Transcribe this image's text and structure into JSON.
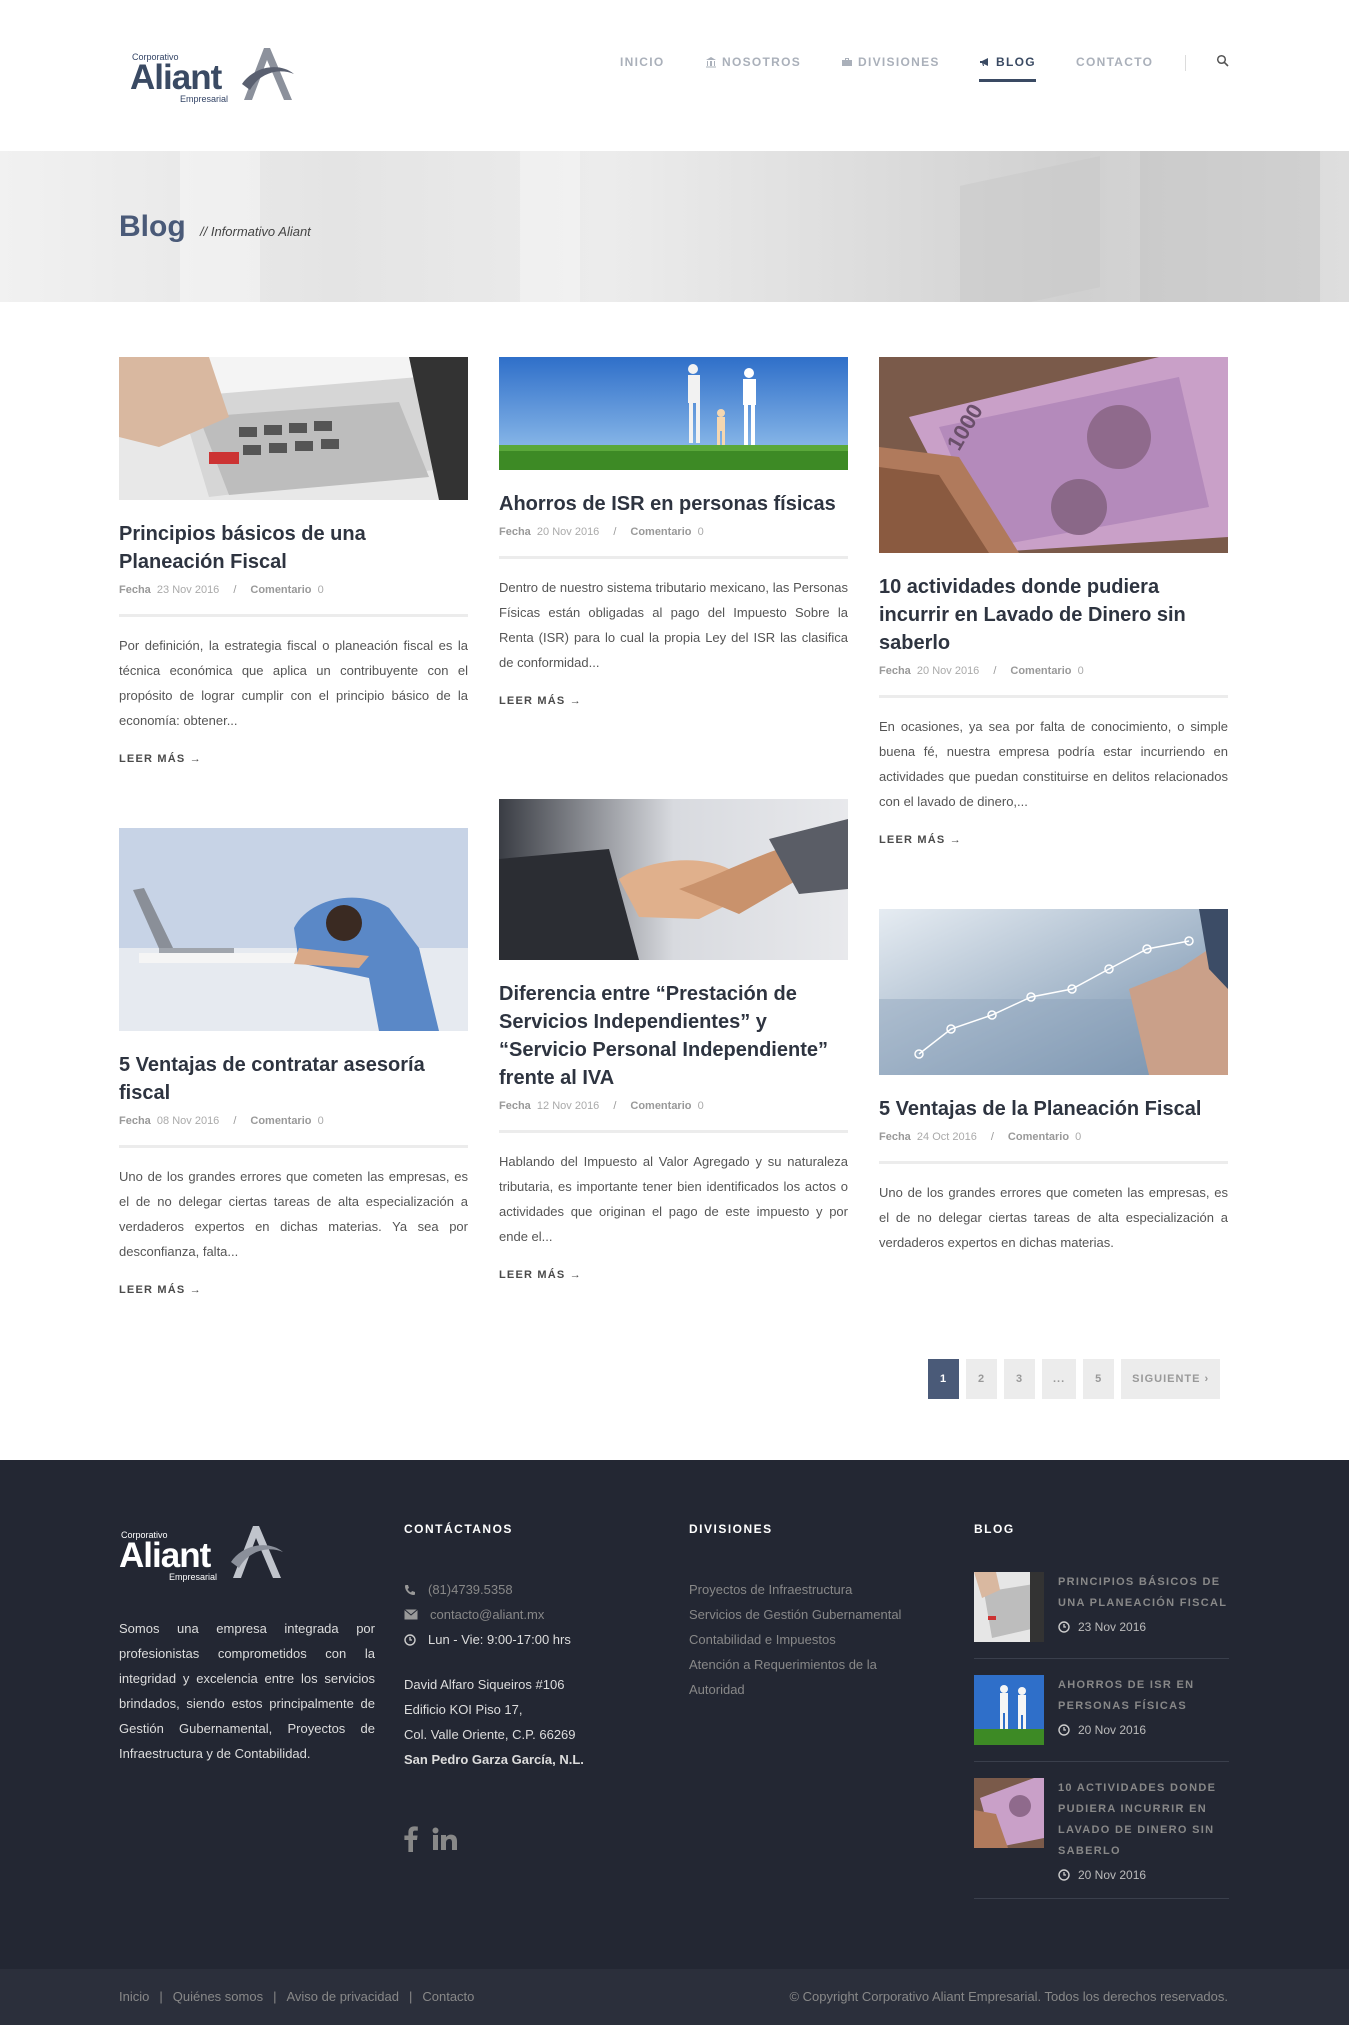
{
  "brand": {
    "corporativo": "Corporativo",
    "name": "Aliant",
    "empresarial": "Empresarial"
  },
  "nav": {
    "items": [
      {
        "label": "INICIO",
        "icon": "none"
      },
      {
        "label": "NOSOTROS",
        "icon": "bank-icon"
      },
      {
        "label": "DIVISIONES",
        "icon": "briefcase-icon"
      },
      {
        "label": "BLOG",
        "icon": "megaphone-icon"
      },
      {
        "label": "CONTACTO",
        "icon": "none"
      }
    ],
    "active": "BLOG"
  },
  "hero": {
    "title": "Blog",
    "subtitle": "// Informativo Aliant"
  },
  "posts": [
    {
      "title": "Principios básicos de una Planeación Fiscal",
      "date_label": "Fecha",
      "date": "23 Nov 2016",
      "comments_label": "Comentario",
      "comments": "0",
      "excerpt": "Por definición, la estrategia fiscal o planeación fiscal es la técnica económica que aplica un contribuyente con el propósito de lograr cumplir con el principio básico de la economía: obtener...",
      "more": "LEER MÁS →"
    },
    {
      "title": "Ahorros de ISR en personas físicas",
      "date_label": "Fecha",
      "date": "20 Nov 2016",
      "comments_label": "Comentario",
      "comments": "0",
      "excerpt": "Dentro de nuestro sistema tributario mexicano, las Personas Físicas están obligadas al pago del Impuesto Sobre la Renta (ISR) para lo cual la propia Ley del ISR las clasifica de conformidad...",
      "more": "LEER MÁS →"
    },
    {
      "title": "10 actividades donde pudiera incurrir en Lavado de Dinero sin saberlo",
      "date_label": "Fecha",
      "date": "20 Nov 2016",
      "comments_label": "Comentario",
      "comments": "0",
      "excerpt": "En ocasiones, ya sea por falta de conocimiento, o simple buena fé, nuestra empresa podría estar incurriendo en actividades que puedan constituirse en delitos relacionados con el lavado de dinero,...",
      "more": "LEER MÁS →"
    },
    {
      "title": "5 Ventajas de contratar asesoría fiscal",
      "date_label": "Fecha",
      "date": "08 Nov 2016",
      "comments_label": "Comentario",
      "comments": "0",
      "excerpt": "Uno de los grandes errores que cometen las empresas, es el de no delegar ciertas tareas de alta especialización a verdaderos expertos en dichas materias. Ya sea por desconfianza, falta...",
      "more": "LEER MÁS →"
    },
    {
      "title": "Diferencia entre “Prestación de Servicios Independientes” y “Servicio Personal Independiente” frente al IVA",
      "date_label": "Fecha",
      "date": "12 Nov 2016",
      "comments_label": "Comentario",
      "comments": "0",
      "excerpt": "Hablando del Impuesto al Valor Agregado y su naturaleza tributaria, es importante tener bien identificados los actos o actividades que originan el pago de este impuesto y por ende el...",
      "more": "LEER MÁS →"
    },
    {
      "title": "5 Ventajas de la Planeación Fiscal",
      "date_label": "Fecha",
      "date": "24 Oct 2016",
      "comments_label": "Comentario",
      "comments": "0",
      "excerpt": "Uno de los grandes errores que cometen las empresas, es el de no delegar ciertas tareas de alta especialización a verdaderos expertos en dichas materias.",
      "more": ""
    }
  ],
  "pagination": {
    "pages": [
      "1",
      "2",
      "3",
      "...",
      "5"
    ],
    "current": "1",
    "next": "SIGUIENTE ›"
  },
  "footer": {
    "about": "Somos una empresa integrada por profesionistas comprometidos con la integridad y excelencia entre los servicios brindados, siendo estos principalmente de Gestión Gubernamental, Proyectos de Infraestructura y de Contabilidad.",
    "contact_title": "CONTÁCTANOS",
    "phone": "(81)4739.5358",
    "email": "contacto@aliant.mx",
    "hours": "Lun - Vie: 9:00-17:00 hrs",
    "address1": "David Alfaro Siqueiros #106",
    "address2": "Edificio KOI Piso 17,",
    "address3": "Col. Valle Oriente, C.P. 66269",
    "address4": "San Pedro Garza García, N.L.",
    "divisions_title": "DIVISIONES",
    "divisions": [
      "Proyectos de Infraestructura",
      "Servicios de Gestión Gubernamental",
      "Contabilidad e Impuestos",
      "Atención a Requerimientos de la Autoridad"
    ],
    "blog_title": "BLOG",
    "blog": [
      {
        "title": "PRINCIPIOS BÁSICOS DE UNA PLANEACIÓN FISCAL",
        "date": "23 Nov 2016"
      },
      {
        "title": "AHORROS DE ISR EN PERSONAS FÍSICAS",
        "date": "20 Nov 2016"
      },
      {
        "title": "10 ACTIVIDADES DONDE PUDIERA INCURRIR EN LAVADO DE DINERO SIN SABERLO",
        "date": "20 Nov 2016"
      }
    ]
  },
  "bottom": {
    "links": [
      "Inicio",
      "Quiénes somos",
      "Aviso de privacidad",
      "Contacto"
    ],
    "copyright": "© Copyright Corporativo Aliant Empresarial. Todos los derechos reservados."
  }
}
